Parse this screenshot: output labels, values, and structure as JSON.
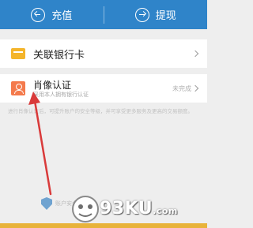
{
  "top_bar": {
    "recharge_label": "充值",
    "withdraw_label": "提现"
  },
  "link_card": {
    "label": "关联银行卡"
  },
  "portrait": {
    "title": "肖像认证",
    "subtitle": "采用本人拥有银行认证",
    "status": "未完成"
  },
  "note": {
    "text": "进行肖像认证后，可提升账户的安全等级，并可享受更多服务及更高的交易额度。"
  },
  "bottom": {
    "security_label": "账户安全保障中"
  },
  "watermark": {
    "text": "93KU",
    "domain": ".com"
  },
  "colors": {
    "top_bar": "#2f84c9",
    "card_icon": "#f4b52b",
    "portrait_icon": "#f47a4c",
    "arrow": "#d93a3a",
    "footer_stripe": "#e8b33a"
  }
}
